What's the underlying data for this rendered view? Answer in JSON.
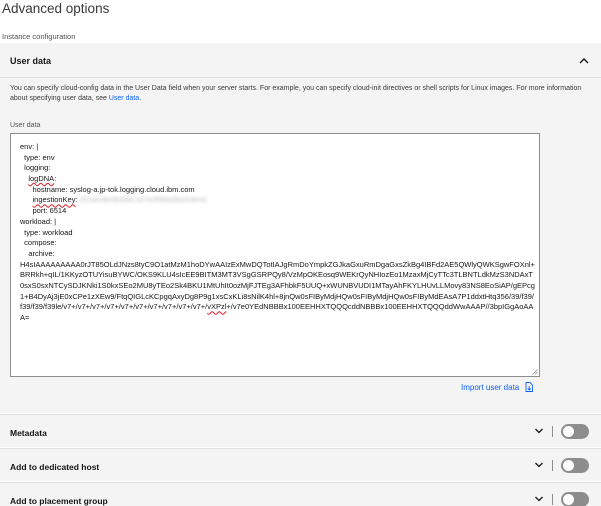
{
  "page": {
    "title": "Advanced options",
    "section_label": "Instance configuration"
  },
  "user_data": {
    "title": "User data",
    "description": "You can specify cloud-config data in the User Data field when your server starts. For example, you can specify cloud-init directives or shell scripts for Linux images. For more information about specifying user data, see ",
    "description_link": "User data",
    "description_end": ".",
    "field_label": "User data",
    "content": {
      "l1": "env: |",
      "l2": "  type: env",
      "l3": "  logging:",
      "l4_a": "    ",
      "l4_b": "logDNA",
      "l4_c": ":",
      "l5": "      hostname: syslog-a.jp-tok.logging.cloud.ibm.com",
      "l6_a": "      ",
      "l6_b": "ingestionKey",
      "l6_c": ": ",
      "l6_d": "2f1a4c8e0b5d4c1a7e3f9b6d5a2c8e41",
      "l7": "      port: 6514",
      "l8": "workload: |",
      "l9": "  type: workload",
      "l10": "  compose:",
      "l11": "    archive:",
      "archive_a": "H4sIAAAAAAAAA0rJT85OLdJNzs8tyC9O1atMzM1hoDYwAAIzExMwDQTotIAJgRmDoYmpkZGJkaGxuRmDgaGxsZkBg4IBFd2AE5QWlyQWKSgwFOXnl+BRRkh+qIL/1KKyzOTUYisuBYWC/OKS9KLU4sIcEE9BITM3MT3VSgGSRPQy8/VzMpOKEosq9WEKrQyNHIozEo1MzaxMjCyTTc3TLBNTLdkMzS3NDAxT0sxS0sxNTCySDJKNki1S0kxSEo2MU8yTEo2Sk4BKU1MtUhIt0ozMjFJTEg3AFhbkF5UUQ+xWUNBVUDI1MTayAhFKYLHUvLLMovy83NS8EoSiAP/gEPcg1+B4DyAj3jE0xCPe1zXEw9/FtqQIGLcKCpgqAxyDg8P9g1xsCxKLi8sNilK4hl+8jnQw0sFIByMdjHQw0sFIByMdjHQw0sFIByMdEAsA7P1ddxtHtq356/39/f39/f39/f39/f39le/v7+/v7+/v7+/v7+/v7+/v7+/v7+/v7+/v7+/v7+/",
      "archive_sq": "vXPzl",
      "archive_b": "+/v7e0YEdNBBBx100EEHHXTQQQcddNBBBx100EEHHXTQQQddWwAAAP//3bpIGgAoAAA="
    },
    "import_label": "Import user data"
  },
  "rows": [
    {
      "title": "Metadata"
    },
    {
      "title": "Add to dedicated host"
    },
    {
      "title": "Add to placement group"
    }
  ],
  "colors": {
    "link": "#0f62fe",
    "panel_bg": "#f4f4f4",
    "toggle_off": "#8d8d8d"
  },
  "icons": {
    "panel_collapse": "chevron-up-icon",
    "row_expand": "chevron-down-icon",
    "import": "document-import-icon"
  }
}
